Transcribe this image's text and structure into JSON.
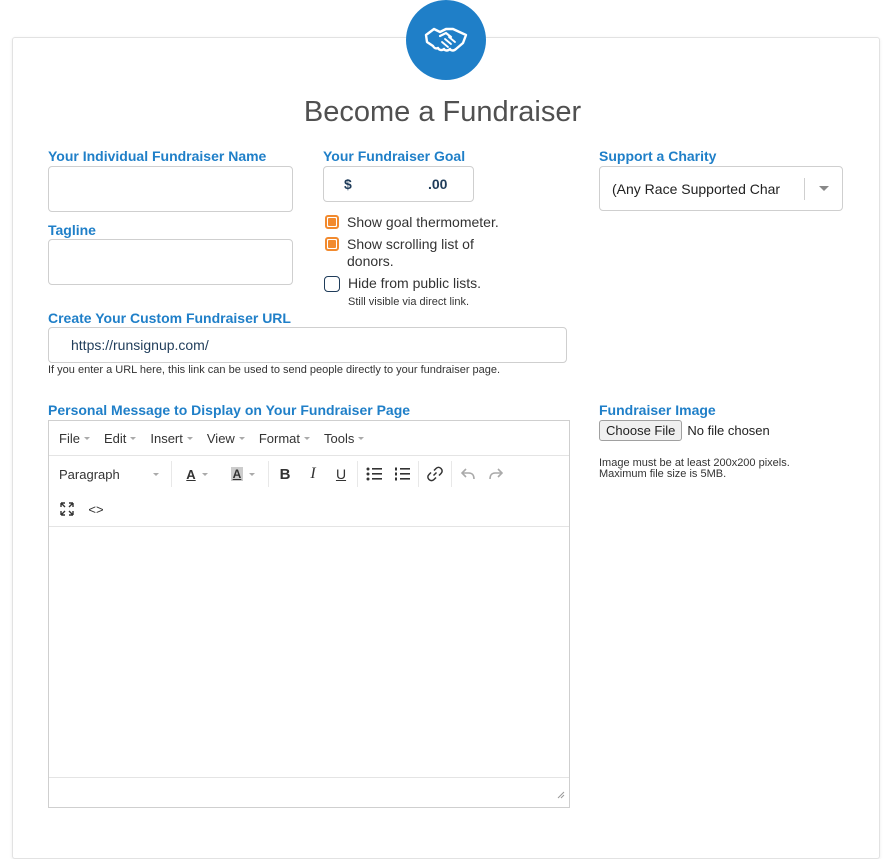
{
  "page": {
    "title": "Become a Fundraiser",
    "logo_icon": "handshake-icon",
    "brand_color": "#1f7fc8",
    "accent_color": "#f28a2e"
  },
  "fields": {
    "name_label": "Your Individual Fundraiser Name",
    "name_value": "",
    "tagline_label": "Tagline",
    "tagline_value": "",
    "goal_label": "Your Fundraiser Goal",
    "goal_currency": "$",
    "goal_value": "",
    "goal_cents": ".00",
    "charity_label": "Support a Charity",
    "charity_selected": "(Any Race Supported Char",
    "url_label": "Create Your Custom Fundraiser URL",
    "url_prefix": "https://runsignup.com/",
    "url_hint": "If you enter a URL here, this link can be used to send people directly to your fundraiser page.",
    "message_label": "Personal Message to Display on Your Fundraiser Page",
    "image_label": "Fundraiser Image",
    "image_button": "Choose File",
    "image_status": "No file chosen",
    "image_hint_line1": "Image must be at least 200x200 pixels.",
    "image_hint_line2": "Maximum file size is 5MB."
  },
  "checkboxes": [
    {
      "label": "Show goal thermometer.",
      "checked": true
    },
    {
      "label": "Show scrolling list of donors.",
      "checked": true
    },
    {
      "label": "Hide from public lists.",
      "checked": false,
      "hint": "Still visible via direct link."
    }
  ],
  "editor": {
    "menus": [
      "File",
      "Edit",
      "Insert",
      "View",
      "Format",
      "Tools"
    ],
    "block_format": "Paragraph",
    "toolbar_icons": [
      "text-color-icon",
      "background-color-icon",
      "bold-icon",
      "italic-icon",
      "underline-icon",
      "bullet-list-icon",
      "numbered-list-icon",
      "link-icon",
      "undo-icon",
      "redo-icon",
      "fullscreen-icon",
      "source-code-icon"
    ],
    "content": ""
  }
}
